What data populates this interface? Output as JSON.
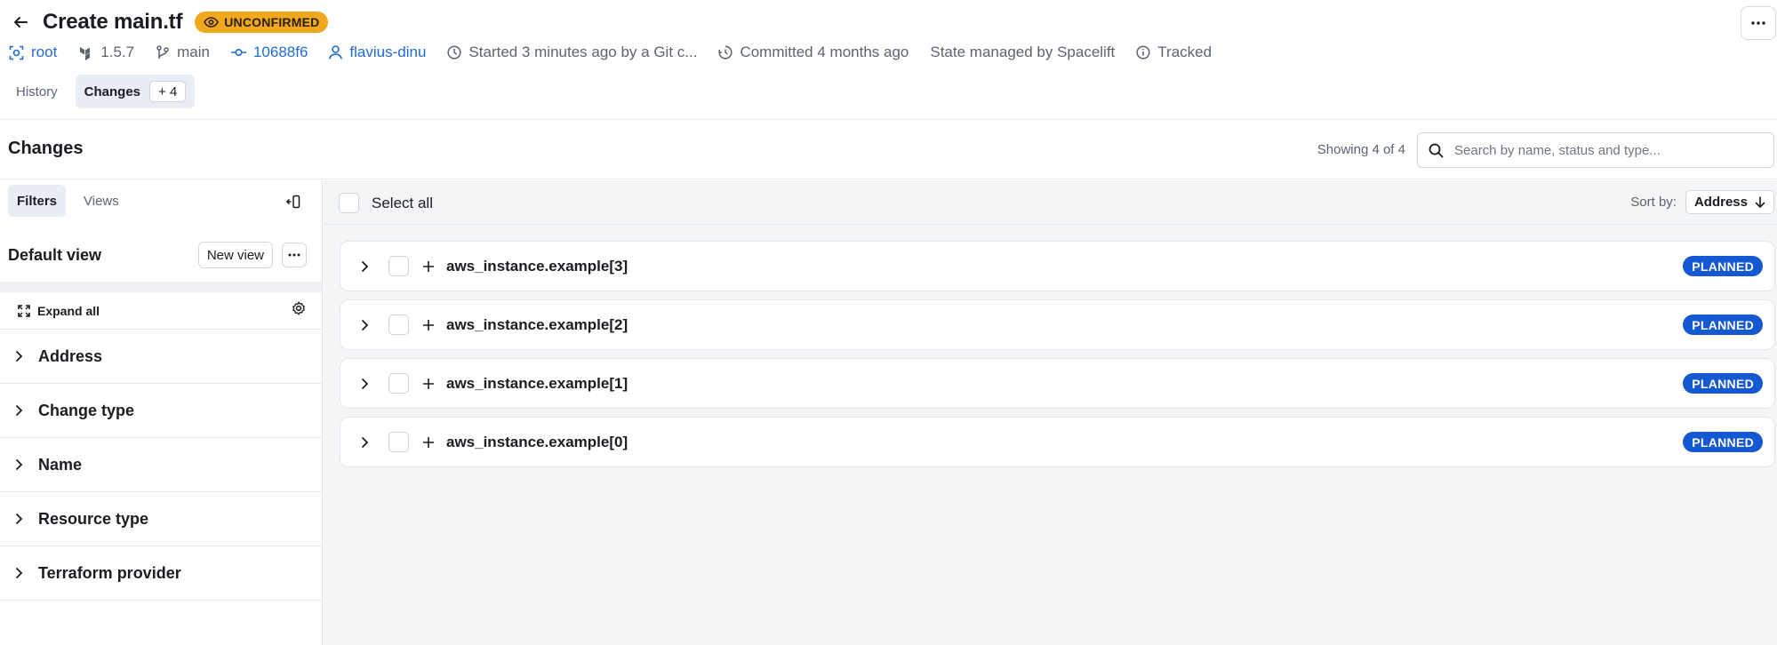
{
  "header": {
    "title": "Create main.tf",
    "status_badge": "UNCONFIRMED",
    "colors": {
      "badge_bg": "#f0a81f",
      "link": "#1f6bd6",
      "planned": "#1458d2"
    }
  },
  "meta": {
    "stack": "root",
    "version": "1.5.7",
    "branch": "main",
    "commit": "10688f6",
    "user": "flavius-dinu",
    "started": "Started 3 minutes ago by a Git c...",
    "committed": "Committed 4 months ago",
    "state": "State managed by Spacelift",
    "tracked": "Tracked"
  },
  "tabs": {
    "history": "History",
    "changes": "Changes",
    "changes_count": "+ 4"
  },
  "section": {
    "title": "Changes",
    "showing": "Showing 4 of 4",
    "search_placeholder": "Search by name, status and type..."
  },
  "sidebar": {
    "tab_filters": "Filters",
    "tab_views": "Views",
    "view_name": "Default view",
    "new_view": "New view",
    "expand_all": "Expand all",
    "filters": [
      "Address",
      "Change type",
      "Name",
      "Resource type",
      "Terraform provider"
    ]
  },
  "list": {
    "select_all": "Select all",
    "sort_label": "Sort by:",
    "sort_value": "Address",
    "rows": [
      {
        "address": "aws_instance.example[3]",
        "status": "PLANNED"
      },
      {
        "address": "aws_instance.example[2]",
        "status": "PLANNED"
      },
      {
        "address": "aws_instance.example[1]",
        "status": "PLANNED"
      },
      {
        "address": "aws_instance.example[0]",
        "status": "PLANNED"
      }
    ]
  }
}
